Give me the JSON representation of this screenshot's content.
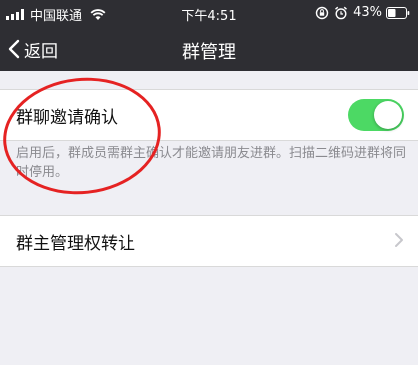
{
  "status_bar": {
    "carrier": "中国联通",
    "time": "下午4:51",
    "battery": "43%",
    "wifi_icon": "wifi-icon",
    "lock_icon": "rotation-lock-icon",
    "alarm_icon": "alarm-icon"
  },
  "nav": {
    "back_label": "返回",
    "title": "群管理"
  },
  "settings": {
    "invite_confirm": {
      "label": "群聊邀请确认",
      "enabled": true,
      "hint": "启用后，群成员需群主确认才能邀请朋友进群。扫描二维码进群将同时停用。"
    },
    "transfer_owner": {
      "label": "群主管理权转让"
    }
  },
  "colors": {
    "nav_background": "#2e2e33",
    "toggle_on": "#4cd964",
    "annotation": "#e52222"
  }
}
